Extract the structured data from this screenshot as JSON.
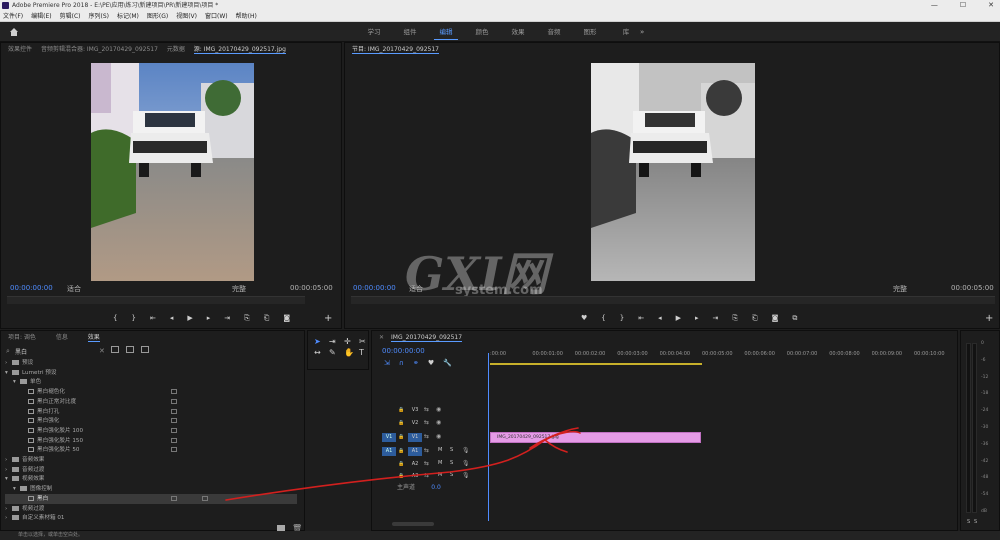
{
  "app": {
    "title": "Adobe Premiere Pro 2018 - E:\\PE\\应用\\练习\\新建项目\\PR\\新建项目\\项目 *"
  },
  "window_controls": {
    "minimize": "—",
    "maximize": "☐",
    "close": "✕"
  },
  "menu": [
    "文件(F)",
    "编辑(E)",
    "剪辑(C)",
    "序列(S)",
    "标记(M)",
    "图形(G)",
    "视图(V)",
    "窗口(W)",
    "帮助(H)"
  ],
  "workspaces": {
    "tabs": [
      "学习",
      "组件",
      "编辑",
      "颜色",
      "效果",
      "音频",
      "图形",
      "库"
    ],
    "active": "编辑",
    "more": "»"
  },
  "source_monitor": {
    "tabs": [
      "效果控件",
      "音频剪辑混合器: IMG_20170429_092517",
      "元数据",
      "源: IMG_20170429_092517.jpg"
    ],
    "timecode_in": "00:00:00:00",
    "fit": "适合",
    "quality": "完整",
    "duration": "00:00:05:00"
  },
  "program_monitor": {
    "tab": "节目: IMG_20170429_092517",
    "timecode_in": "00:00:00:00",
    "fit": "适合",
    "quality": "完整",
    "duration": "00:00:05:00"
  },
  "effects_panel": {
    "tabs": [
      "项目: 调色",
      "信息",
      "效果"
    ],
    "active_tab": "效果",
    "search_value": "黑白",
    "tree": [
      {
        "label": "预设",
        "level": 0,
        "kind": "folder",
        "open": false
      },
      {
        "label": "Lumetri 预设",
        "level": 0,
        "kind": "folder",
        "open": true
      },
      {
        "label": "单色",
        "level": 1,
        "kind": "folder",
        "open": true
      },
      {
        "label": "黑白褪色化",
        "level": 2,
        "kind": "fx"
      },
      {
        "label": "黑白正常对比度",
        "level": 2,
        "kind": "fx"
      },
      {
        "label": "黑白打孔",
        "level": 2,
        "kind": "fx"
      },
      {
        "label": "黑白强化",
        "level": 2,
        "kind": "fx"
      },
      {
        "label": "黑白强化胶片 100",
        "level": 2,
        "kind": "fx"
      },
      {
        "label": "黑白强化胶片 150",
        "level": 2,
        "kind": "fx"
      },
      {
        "label": "黑白强化胶片 50",
        "level": 2,
        "kind": "fx"
      },
      {
        "label": "音频效果",
        "level": 0,
        "kind": "folder",
        "open": false
      },
      {
        "label": "音频过渡",
        "level": 0,
        "kind": "folder",
        "open": false
      },
      {
        "label": "视频效果",
        "level": 0,
        "kind": "folder",
        "open": true
      },
      {
        "label": "图像控制",
        "level": 1,
        "kind": "folder",
        "open": true
      },
      {
        "label": "黑白",
        "level": 2,
        "kind": "fx",
        "selected": true
      },
      {
        "label": "视频过渡",
        "level": 0,
        "kind": "folder",
        "open": false
      },
      {
        "label": "自定义素材箱 01",
        "level": 0,
        "kind": "folder",
        "open": false
      }
    ]
  },
  "timeline": {
    "tab": "IMG_20170429_092517",
    "timecode": "00:00:00:00",
    "ruler": [
      ":00:00",
      "00:00:01:00",
      "00:00:02:00",
      "00:00:03:00",
      "00:00:04:00",
      "00:00:05:00",
      "00:00:06:00",
      "00:00:07:00",
      "00:00:08:00",
      "00:00:09:00",
      "00:00:10:00"
    ],
    "video_tracks": [
      "V3",
      "V2",
      "V1"
    ],
    "audio_tracks": [
      "A1",
      "A2",
      "A3"
    ],
    "source_v": "V1",
    "source_a": "A1",
    "master_label": "主声道",
    "master_value": "0.0",
    "clip_label": "IMG_20170429_092517.jpg",
    "ms_labels": [
      "M",
      "S"
    ]
  },
  "meters": {
    "scale": [
      "0",
      "-6",
      "-12",
      "-18",
      "-24",
      "-30",
      "-36",
      "-42",
      "-48",
      "-54",
      "dB"
    ],
    "footer": [
      "S",
      "S"
    ]
  },
  "status_bar": "单击以选择，或单击空白处。",
  "watermark": {
    "text": "GXI网",
    "sub": "system.com"
  },
  "colors": {
    "accent": "#4f8cff",
    "clip": "#e59be6",
    "annotation": "#d2201e"
  }
}
